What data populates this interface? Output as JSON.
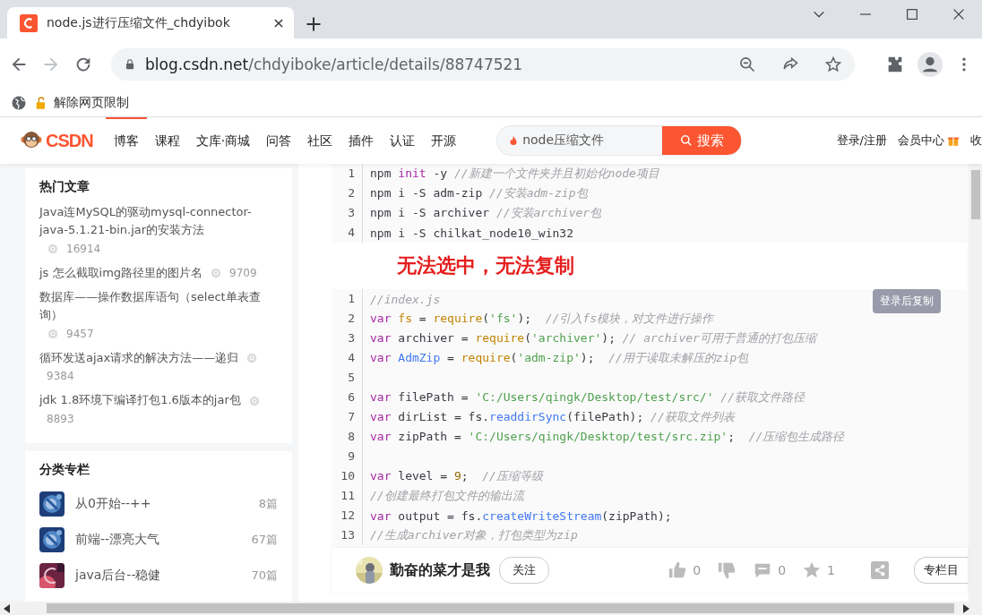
{
  "browser": {
    "tab": {
      "title": "node.js进行压缩文件_chdyibok"
    },
    "nav_buttons": [
      {
        "kind": "back",
        "disabled": false
      },
      {
        "kind": "forward",
        "disabled": true
      },
      {
        "kind": "reload",
        "disabled": false
      }
    ],
    "url_host": "blog.csdn.net",
    "url_path": "/chdyiboke/article/details/88747521",
    "bookmark": "解除网页限制"
  },
  "site_nav": {
    "logo": "CSDN",
    "items": [
      {
        "label": "博客",
        "selected": true
      },
      {
        "label": "课程",
        "selected": false
      },
      {
        "label": "文库·商城",
        "selected": false
      },
      {
        "label": "问答",
        "selected": false
      },
      {
        "label": "社区",
        "selected": false
      },
      {
        "label": "插件",
        "selected": false
      },
      {
        "label": "认证",
        "selected": false
      },
      {
        "label": "开源",
        "selected": false
      }
    ],
    "search": {
      "value": "node压缩文件",
      "button": "搜索"
    },
    "login": "登录/注册",
    "vip": "会员中心",
    "more": "收"
  },
  "hot_articles": {
    "title": "热门文章",
    "items": [
      {
        "title": "Java连MySQL的驱动mysql-connector-java-5.1.21-bin.jar的安装方法",
        "views": "16914"
      },
      {
        "title": "js 怎么截取img路径里的图片名",
        "views": "9709"
      },
      {
        "title": "数据库——操作数据库语句（select单表查询）",
        "views": "9457"
      },
      {
        "title": "循环发送ajax请求的解决方法——递归",
        "views": "9384"
      },
      {
        "title": "jdk 1.8环境下编译打包1.6版本的jar包",
        "views": "8893"
      }
    ]
  },
  "categories": {
    "title": "分类专栏",
    "items": [
      {
        "name": "从0开始--++",
        "count": "8篇"
      },
      {
        "name": "前端--漂亮大气",
        "count": "67篇"
      },
      {
        "name": "java后台--稳健",
        "count": "70篇"
      }
    ]
  },
  "code_blocks": [
    {
      "lines": [
        {
          "num": "1",
          "tokens": [
            {
              "kind": "plain",
              "t": "npm "
            },
            {
              "kind": "keyword",
              "t": "init"
            },
            {
              "kind": "plain",
              "t": " -y "
            },
            {
              "kind": "comment",
              "t": "//新建一个文件夹并且初始化node项目"
            }
          ]
        },
        {
          "num": "2",
          "tokens": [
            {
              "kind": "plain",
              "t": "npm i -S adm-zip "
            },
            {
              "kind": "comment",
              "t": "//安装adm-zip包"
            }
          ]
        },
        {
          "num": "3",
          "tokens": [
            {
              "kind": "plain",
              "t": "npm i -S archiver "
            },
            {
              "kind": "comment",
              "t": "//安装archiver包"
            }
          ]
        },
        {
          "num": "4",
          "tokens": [
            {
              "kind": "plain",
              "t": "npm i -S chilkat_node10_win32"
            }
          ]
        }
      ]
    },
    {
      "copy_button": "登录后复制",
      "lines": [
        {
          "num": "1",
          "tokens": [
            {
              "kind": "comment",
              "t": "//index.js"
            }
          ]
        },
        {
          "num": "2",
          "tokens": [
            {
              "kind": "keyword",
              "t": "var "
            },
            {
              "kind": "call",
              "t": "fs"
            },
            {
              "kind": "plain",
              "t": " = "
            },
            {
              "kind": "call",
              "t": "require"
            },
            {
              "kind": "plain",
              "t": "("
            },
            {
              "kind": "string",
              "t": "'fs'"
            },
            {
              "kind": "plain",
              "t": ");  "
            },
            {
              "kind": "comment",
              "t": "//引入fs模块，对文件进行操作"
            }
          ]
        },
        {
          "num": "3",
          "tokens": [
            {
              "kind": "keyword",
              "t": "var"
            },
            {
              "kind": "plain",
              "t": " archiver = "
            },
            {
              "kind": "call",
              "t": "require"
            },
            {
              "kind": "plain",
              "t": "("
            },
            {
              "kind": "string",
              "t": "'archiver'"
            },
            {
              "kind": "plain",
              "t": "); "
            },
            {
              "kind": "comment",
              "t": "// archiver可用于普通的打包压缩"
            }
          ]
        },
        {
          "num": "4",
          "tokens": [
            {
              "kind": "keyword",
              "t": "var "
            },
            {
              "kind": "function",
              "t": "AdmZip"
            },
            {
              "kind": "plain",
              "t": " = "
            },
            {
              "kind": "call",
              "t": "require"
            },
            {
              "kind": "plain",
              "t": "("
            },
            {
              "kind": "string",
              "t": "'adm-zip'"
            },
            {
              "kind": "plain",
              "t": ");  "
            },
            {
              "kind": "comment",
              "t": "//用于读取未解压的zip包"
            }
          ]
        },
        {
          "num": "5"
        },
        {
          "num": "6",
          "tokens": [
            {
              "kind": "keyword",
              "t": "var"
            },
            {
              "kind": "plain",
              "t": " filePath = "
            },
            {
              "kind": "string",
              "t": "'C:/Users/qingk/Desktop/test/src/'"
            },
            {
              "kind": "comment",
              "t": " //获取文件路径"
            }
          ]
        },
        {
          "num": "7",
          "tokens": [
            {
              "kind": "keyword",
              "t": "var"
            },
            {
              "kind": "plain",
              "t": " dirList = fs."
            },
            {
              "kind": "function",
              "t": "readdirSync"
            },
            {
              "kind": "plain",
              "t": "(filePath); "
            },
            {
              "kind": "comment",
              "t": "//获取文件列表"
            }
          ]
        },
        {
          "num": "8",
          "tokens": [
            {
              "kind": "keyword",
              "t": "var"
            },
            {
              "kind": "plain",
              "t": " zipPath = "
            },
            {
              "kind": "string",
              "t": "'C:/Users/qingk/Desktop/test/src.zip'"
            },
            {
              "kind": "plain",
              "t": ";  "
            },
            {
              "kind": "comment",
              "t": "//压缩包生成路径"
            }
          ]
        },
        {
          "num": "9"
        },
        {
          "num": "10",
          "tokens": [
            {
              "kind": "keyword",
              "t": "var"
            },
            {
              "kind": "plain",
              "t": " level = "
            },
            {
              "kind": "number",
              "t": "9"
            },
            {
              "kind": "plain",
              "t": ";  "
            },
            {
              "kind": "comment",
              "t": "//压缩等级"
            }
          ]
        },
        {
          "num": "11",
          "tokens": [
            {
              "kind": "comment",
              "t": "//创建最终打包文件的输出流"
            }
          ]
        },
        {
          "num": "12",
          "tokens": [
            {
              "kind": "keyword",
              "t": "var"
            },
            {
              "kind": "plain",
              "t": " output = fs."
            },
            {
              "kind": "function",
              "t": "createWriteStream"
            },
            {
              "kind": "plain",
              "t": "(zipPath);"
            }
          ]
        },
        {
          "num": "13",
          "tokens": [
            {
              "kind": "comment",
              "t": "//生成archiver对象，打包类型为zip"
            }
          ]
        }
      ]
    }
  ],
  "overlay_note": "无法选中，无法复制",
  "author_bar": {
    "name": "勤奋的菜才是我",
    "follow": "关注",
    "likes": "0",
    "comments": "0",
    "favorites": "1",
    "column_button": "专栏目"
  }
}
